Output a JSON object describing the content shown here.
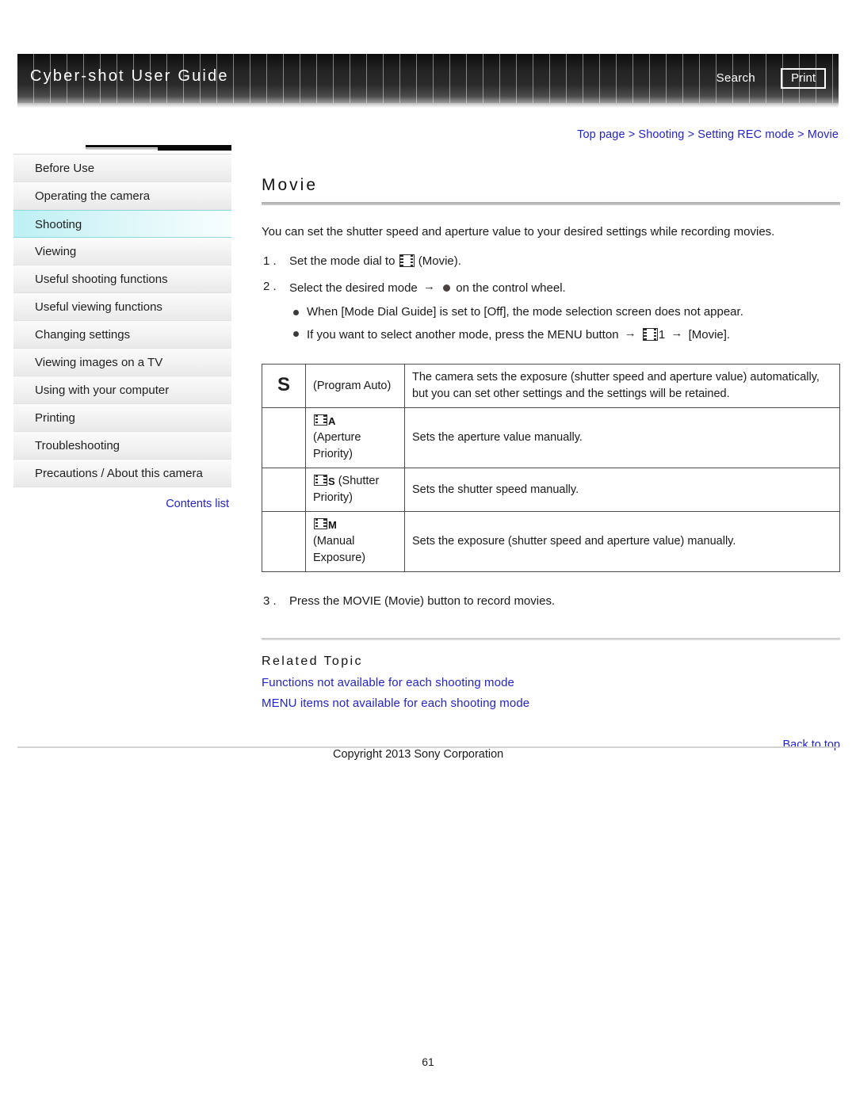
{
  "header": {
    "title": "Cyber-shot User Guide",
    "search_label": "Search",
    "print_label": "Print"
  },
  "breadcrumb": {
    "text": "Top page > Shooting > Setting REC mode > Movie"
  },
  "sidebar": {
    "items": [
      {
        "label": "Before Use",
        "active": false
      },
      {
        "label": "Operating the camera",
        "active": false
      },
      {
        "label": "Shooting",
        "active": true
      },
      {
        "label": "Viewing",
        "active": false
      },
      {
        "label": "Useful shooting functions",
        "active": false
      },
      {
        "label": "Useful viewing functions",
        "active": false
      },
      {
        "label": "Changing settings",
        "active": false
      },
      {
        "label": "Viewing images on a TV",
        "active": false
      },
      {
        "label": "Using with your computer",
        "active": false
      },
      {
        "label": "Printing",
        "active": false
      },
      {
        "label": "Troubleshooting",
        "active": false
      },
      {
        "label": "Precautions / About this camera",
        "active": false
      }
    ],
    "contents_list_label": "Contents list"
  },
  "main": {
    "title": "Movie",
    "lead": "You can set the shutter speed and aperture value to your desired settings while recording movies.",
    "step1": {
      "number": "1 .",
      "before_icon": "Set the mode dial to",
      "icon": "film-icon",
      "after_icon": "(Movie)."
    },
    "step2": {
      "number": "2 .",
      "before": "Select the desired mode",
      "arrow": "→",
      "dot_icon": "dot-icon",
      "after": "on the control wheel.",
      "bullets": [
        {
          "text_full": "When [Mode Dial Guide] is set to [Off], the mode selection screen does not appear.",
          "kind": "plain"
        },
        {
          "kind": "rich",
          "part1": "If you want to select another mode, press the MENU button",
          "arrow1": "→",
          "icon": "film-icon",
          "icon_suffix": "1",
          "arrow2": "→",
          "part2": "[Movie]."
        }
      ]
    },
    "step3": {
      "number": "3 .",
      "text": "Press the MOVIE (Movie) button to record movies."
    },
    "mode_table": {
      "rows": [
        {
          "icon_glyph": "S",
          "icon_kind": "s-letter",
          "mode_label": "(Program Auto)",
          "description": "The camera sets the exposure (shutter speed and aperture value) automatically, but you can set other settings and the settings will be retained."
        },
        {
          "icon_glyph": "",
          "icon_kind": "film-a",
          "film_letter": "A",
          "mode_label": "(Aperture Priority)",
          "description": "Sets the aperture value manually."
        },
        {
          "icon_glyph": "",
          "icon_kind": "film-s",
          "film_letter": "S",
          "mode_label": "(Shutter Priority)",
          "description": "Sets the shutter speed manually."
        },
        {
          "icon_glyph": "",
          "icon_kind": "film-m",
          "film_letter": "M",
          "mode_label": "(Manual Exposure)",
          "description": "Sets the exposure (shutter speed and aperture value) manually."
        }
      ]
    },
    "related": {
      "heading": "Related Topic",
      "links": [
        "Functions not available for each shooting mode",
        "MENU items not available for each shooting mode"
      ]
    },
    "back_to_top_label": "Back to top"
  },
  "footer": {
    "copyright": "Copyright 2013 Sony Corporation",
    "page_number": "61"
  },
  "colors": {
    "link_blue": "#2323c8",
    "active_nav_cyan": "#bdf0f4",
    "header_dark": "#1a1a1a"
  }
}
